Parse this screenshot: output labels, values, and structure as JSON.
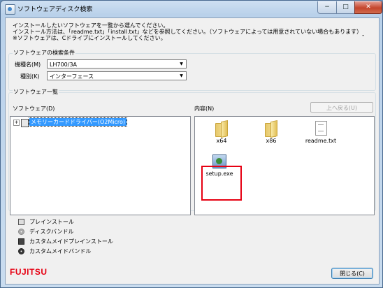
{
  "window": {
    "title": "ソフトウェアディスク検索",
    "min_glyph": "−",
    "max_glyph": "□",
    "close_glyph": "✕",
    "app_icon": "disc-search-icon"
  },
  "intro": {
    "line1": "インストールしたいソフトウェアを一覧から選んでください。",
    "line2": "インストール方法は、「readme.txt」「install.txt」などを参照してください。（ソフトウェアによっては用意されていない場合もあります）",
    "line3": "※ソフトウェアは、Cドライブにインストールしてください。",
    "dash": "-"
  },
  "search": {
    "group_label": "ソフトウェアの検索条件",
    "model_label": "機種名(M)",
    "model_value": "LH700/3A",
    "type_label": "種別(K)",
    "type_value": "インターフェース",
    "dropdown_glyph": "▼"
  },
  "list": {
    "group_label": "ソフトウェア一覧",
    "software_label": "ソフトウェア(D)",
    "content_label": "内容(N)",
    "up_button": "上へ戻る(U)",
    "tree_items": [
      {
        "expander": "+",
        "label": "メモリーカードドライバー(O2Micro)"
      }
    ],
    "files": [
      {
        "name": "x64",
        "icon": "folder-icon"
      },
      {
        "name": "x86",
        "icon": "folder-icon"
      },
      {
        "name": "readme.txt",
        "icon": "text-file-icon"
      },
      {
        "name": "setup.exe",
        "icon": "setup-exe-icon"
      }
    ]
  },
  "legend": [
    {
      "icon": "preinstall-icon",
      "label": "プレインストール"
    },
    {
      "icon": "disc-bundle-icon",
      "label": "ディスクバンドル"
    },
    {
      "icon": "custom-preinstall-icon",
      "label": "カスタムメイドプレインストール"
    },
    {
      "icon": "custom-bundle-icon",
      "label": "カスタムメイドバンドル"
    }
  ],
  "footer": {
    "logo": "FUJITSU",
    "close_button": "閉じる(C)"
  },
  "colors": {
    "selection": "#3399ff",
    "highlight_box": "#e60012",
    "logo": "#e60012",
    "title_bar": "#b9d1ea"
  }
}
